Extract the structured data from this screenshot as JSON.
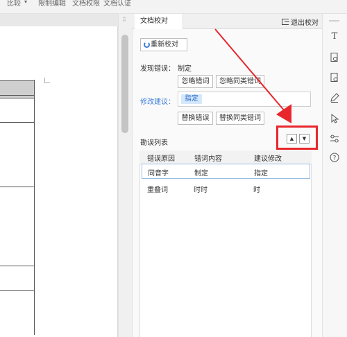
{
  "ribbon": {
    "items": [
      "比较",
      "限制编辑",
      "文档权限",
      "文档认证"
    ]
  },
  "panel": {
    "tab_title": "文档校对",
    "exit_label": "退出校对",
    "recheck_label": "重新校对",
    "found_error_label": "发现错误：",
    "found_error_word": "制定",
    "ignore_error_label": "忽略错词",
    "ignore_same_label": "忽略同类错词",
    "suggestion_label": "修改建议：",
    "suggestion_value": "指定",
    "replace_error_label": "替换错误",
    "replace_same_label": "替换同类错词",
    "list_title": "勘误列表",
    "sort_up": "▲",
    "sort_down": "▼"
  },
  "error_table": {
    "columns": [
      "错误原因",
      "错词内容",
      "建议修改"
    ],
    "rows": [
      {
        "reason": "同音字",
        "content": "制定",
        "suggestion": "指定"
      },
      {
        "reason": "重叠词",
        "content": "时时",
        "suggestion": "时"
      }
    ]
  },
  "toolbar": {
    "icons": [
      "text-icon",
      "document-search-icon",
      "document-settings-icon",
      "pen-icon",
      "pointer-icon",
      "sliders-icon",
      "help-icon"
    ]
  },
  "colors": {
    "accent": "#3b7ed8",
    "highlight_red": "#e8262c",
    "chip_bg": "#d6e8fb"
  }
}
